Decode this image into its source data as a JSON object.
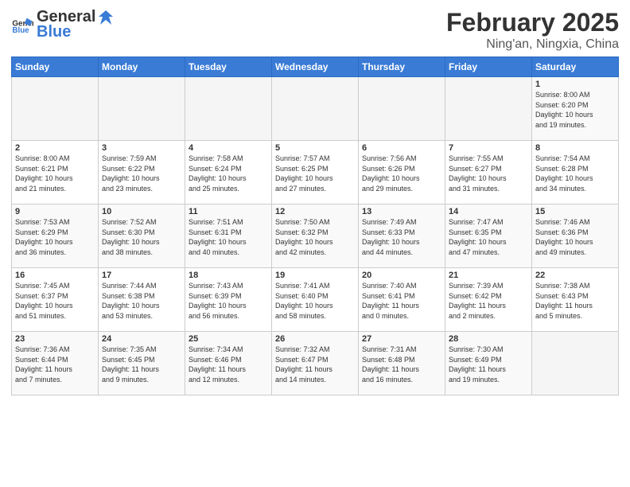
{
  "header": {
    "logo_general": "General",
    "logo_blue": "Blue",
    "month": "February 2025",
    "location": "Ning'an, Ningxia, China"
  },
  "days_of_week": [
    "Sunday",
    "Monday",
    "Tuesday",
    "Wednesday",
    "Thursday",
    "Friday",
    "Saturday"
  ],
  "weeks": [
    [
      {
        "day": "",
        "info": ""
      },
      {
        "day": "",
        "info": ""
      },
      {
        "day": "",
        "info": ""
      },
      {
        "day": "",
        "info": ""
      },
      {
        "day": "",
        "info": ""
      },
      {
        "day": "",
        "info": ""
      },
      {
        "day": "1",
        "info": "Sunrise: 8:00 AM\nSunset: 6:20 PM\nDaylight: 10 hours\nand 19 minutes."
      }
    ],
    [
      {
        "day": "2",
        "info": "Sunrise: 8:00 AM\nSunset: 6:21 PM\nDaylight: 10 hours\nand 21 minutes."
      },
      {
        "day": "3",
        "info": "Sunrise: 7:59 AM\nSunset: 6:22 PM\nDaylight: 10 hours\nand 23 minutes."
      },
      {
        "day": "4",
        "info": "Sunrise: 7:58 AM\nSunset: 6:24 PM\nDaylight: 10 hours\nand 25 minutes."
      },
      {
        "day": "5",
        "info": "Sunrise: 7:57 AM\nSunset: 6:25 PM\nDaylight: 10 hours\nand 27 minutes."
      },
      {
        "day": "6",
        "info": "Sunrise: 7:56 AM\nSunset: 6:26 PM\nDaylight: 10 hours\nand 29 minutes."
      },
      {
        "day": "7",
        "info": "Sunrise: 7:55 AM\nSunset: 6:27 PM\nDaylight: 10 hours\nand 31 minutes."
      },
      {
        "day": "8",
        "info": "Sunrise: 7:54 AM\nSunset: 6:28 PM\nDaylight: 10 hours\nand 34 minutes."
      }
    ],
    [
      {
        "day": "9",
        "info": "Sunrise: 7:53 AM\nSunset: 6:29 PM\nDaylight: 10 hours\nand 36 minutes."
      },
      {
        "day": "10",
        "info": "Sunrise: 7:52 AM\nSunset: 6:30 PM\nDaylight: 10 hours\nand 38 minutes."
      },
      {
        "day": "11",
        "info": "Sunrise: 7:51 AM\nSunset: 6:31 PM\nDaylight: 10 hours\nand 40 minutes."
      },
      {
        "day": "12",
        "info": "Sunrise: 7:50 AM\nSunset: 6:32 PM\nDaylight: 10 hours\nand 42 minutes."
      },
      {
        "day": "13",
        "info": "Sunrise: 7:49 AM\nSunset: 6:33 PM\nDaylight: 10 hours\nand 44 minutes."
      },
      {
        "day": "14",
        "info": "Sunrise: 7:47 AM\nSunset: 6:35 PM\nDaylight: 10 hours\nand 47 minutes."
      },
      {
        "day": "15",
        "info": "Sunrise: 7:46 AM\nSunset: 6:36 PM\nDaylight: 10 hours\nand 49 minutes."
      }
    ],
    [
      {
        "day": "16",
        "info": "Sunrise: 7:45 AM\nSunset: 6:37 PM\nDaylight: 10 hours\nand 51 minutes."
      },
      {
        "day": "17",
        "info": "Sunrise: 7:44 AM\nSunset: 6:38 PM\nDaylight: 10 hours\nand 53 minutes."
      },
      {
        "day": "18",
        "info": "Sunrise: 7:43 AM\nSunset: 6:39 PM\nDaylight: 10 hours\nand 56 minutes."
      },
      {
        "day": "19",
        "info": "Sunrise: 7:41 AM\nSunset: 6:40 PM\nDaylight: 10 hours\nand 58 minutes."
      },
      {
        "day": "20",
        "info": "Sunrise: 7:40 AM\nSunset: 6:41 PM\nDaylight: 11 hours\nand 0 minutes."
      },
      {
        "day": "21",
        "info": "Sunrise: 7:39 AM\nSunset: 6:42 PM\nDaylight: 11 hours\nand 2 minutes."
      },
      {
        "day": "22",
        "info": "Sunrise: 7:38 AM\nSunset: 6:43 PM\nDaylight: 11 hours\nand 5 minutes."
      }
    ],
    [
      {
        "day": "23",
        "info": "Sunrise: 7:36 AM\nSunset: 6:44 PM\nDaylight: 11 hours\nand 7 minutes."
      },
      {
        "day": "24",
        "info": "Sunrise: 7:35 AM\nSunset: 6:45 PM\nDaylight: 11 hours\nand 9 minutes."
      },
      {
        "day": "25",
        "info": "Sunrise: 7:34 AM\nSunset: 6:46 PM\nDaylight: 11 hours\nand 12 minutes."
      },
      {
        "day": "26",
        "info": "Sunrise: 7:32 AM\nSunset: 6:47 PM\nDaylight: 11 hours\nand 14 minutes."
      },
      {
        "day": "27",
        "info": "Sunrise: 7:31 AM\nSunset: 6:48 PM\nDaylight: 11 hours\nand 16 minutes."
      },
      {
        "day": "28",
        "info": "Sunrise: 7:30 AM\nSunset: 6:49 PM\nDaylight: 11 hours\nand 19 minutes."
      },
      {
        "day": "",
        "info": ""
      }
    ]
  ]
}
